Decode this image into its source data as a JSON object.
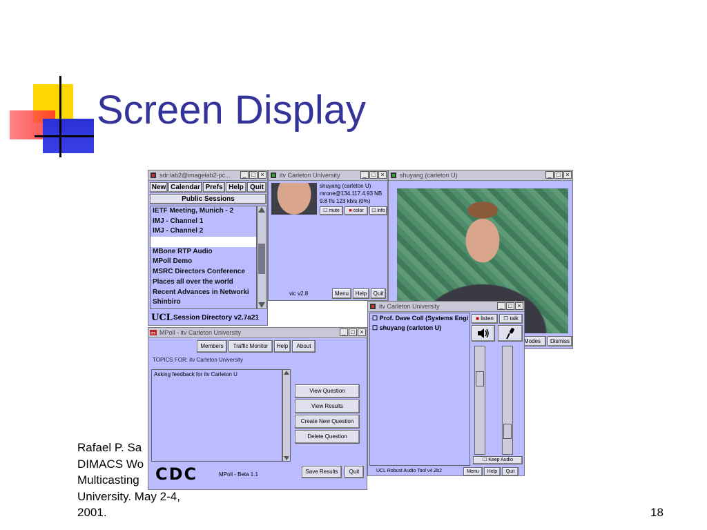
{
  "slide": {
    "title": "Screen Display",
    "footer_lines": [
      "Rafael P. Sa",
      "DIMACS Wo",
      "Multicasting",
      "University.  May 2-4,",
      "2001."
    ],
    "page_number": "18"
  },
  "sdr": {
    "title": "sdr:lab2@imagelab2-pc...",
    "menu": [
      "New",
      "Calendar",
      "Prefs",
      "Help",
      "Quit"
    ],
    "public_sessions": "Public Sessions",
    "sessions": [
      "IETF Meeting, Munich - 2",
      "IMJ - Channel 1",
      "IMJ - Channel 2",
      "",
      "MBone RTP Audio",
      "MPoll Demo",
      "MSRC Directors Conference",
      "Places all over the world",
      "Recent Advances in Networki",
      "Shinbiro"
    ],
    "logo": "UCL",
    "version": "Session Directory v2.7a21"
  },
  "vic_small": {
    "title": "itv Carleton University",
    "info": [
      "shuyang (carleton U)",
      "mrone@134.117.4.93 NB",
      "9.8 f/s   123 kb/s   (0%)"
    ],
    "checks": [
      "mute",
      "color",
      "info"
    ],
    "status": "vic v2.8",
    "buttons": [
      "Menu",
      "Help",
      "Quit"
    ]
  },
  "vic_large": {
    "title": "shuyang (carleton U)",
    "buttons": [
      "Modes",
      "Dismiss"
    ]
  },
  "mpoll": {
    "title": "MPoll - itv Carleton University",
    "tabs": [
      "Members",
      "Traffic Monitor",
      "Help",
      "About"
    ],
    "topics": "TOPICS FOR: itv Carleton University",
    "question": "Asking feedback for itv Carleton U",
    "actions": [
      "View Question",
      "View Results",
      "Create New Question",
      "Delete Question"
    ],
    "logo": "CDC",
    "version": "MPoll - Beta 1.1",
    "bottom_buttons": [
      "Save Results",
      "Quit"
    ]
  },
  "rat": {
    "title": "itv Carleton University",
    "participants": [
      "Prof. Dave Coll (Systems Engi",
      "shuyang (carleton U)"
    ],
    "listen": "listen",
    "talk": "talk",
    "keep_audio": "Keep Audio",
    "version": "UCL Robust Audio Tool v4.2b2",
    "buttons": [
      "Menu",
      "Help",
      "Quit"
    ]
  }
}
